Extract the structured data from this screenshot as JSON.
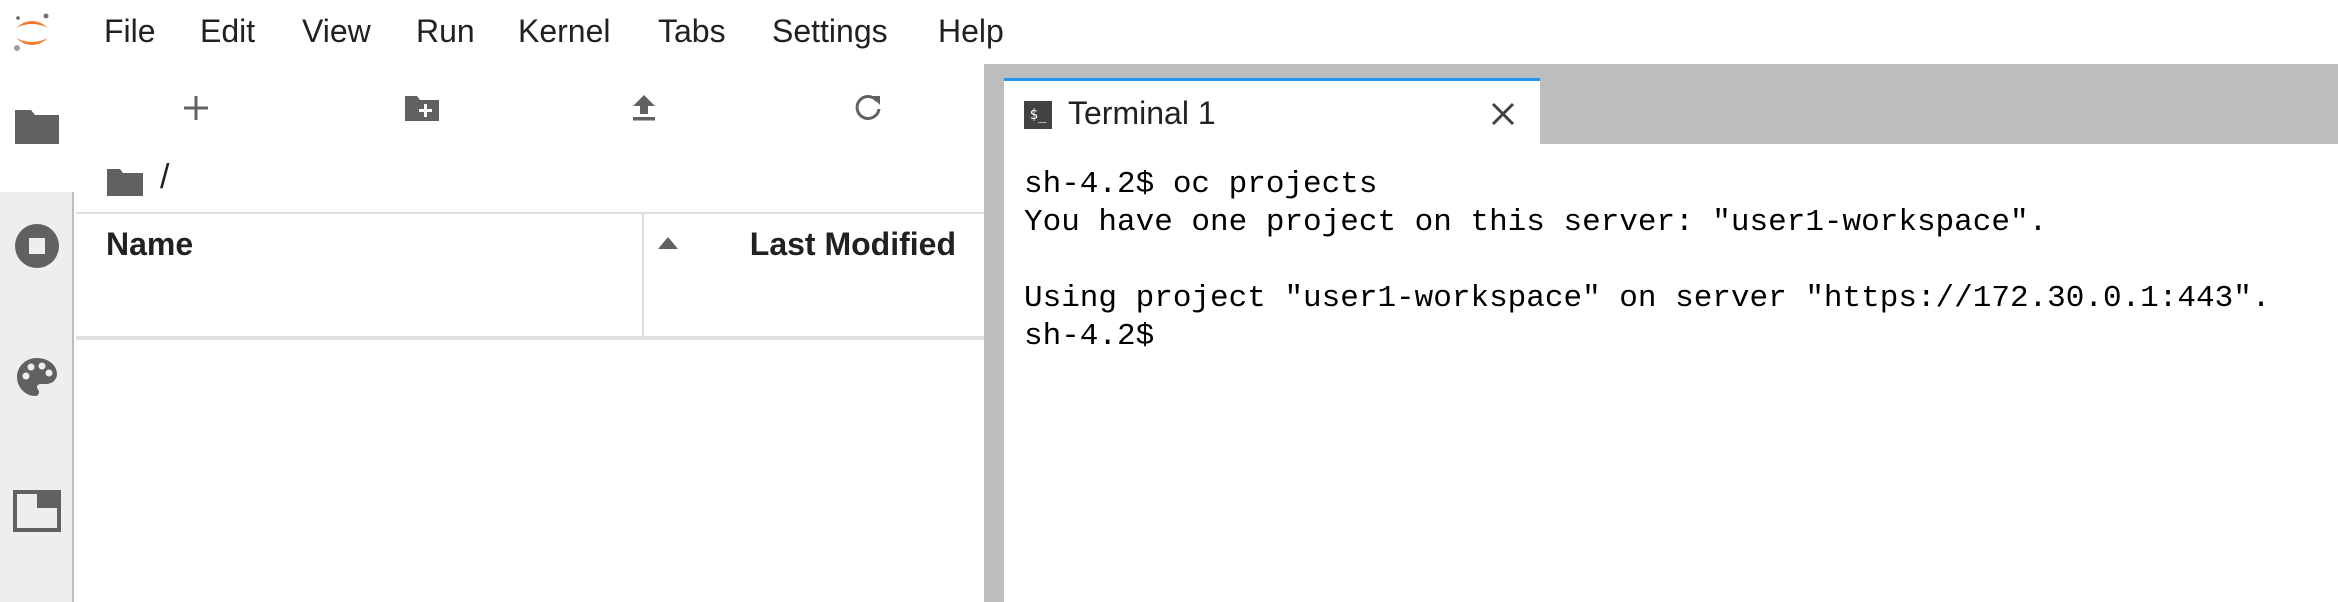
{
  "menubar": {
    "logo": "jupyter-logo",
    "items": [
      "File",
      "Edit",
      "View",
      "Run",
      "Kernel",
      "Tabs",
      "Settings",
      "Help"
    ]
  },
  "activity_bar": {
    "tabs": [
      {
        "icon": "folder-icon",
        "active": true
      },
      {
        "icon": "stop-circle-icon",
        "active": false
      },
      {
        "icon": "palette-icon",
        "active": false
      },
      {
        "icon": "tabs-icon",
        "active": false
      }
    ]
  },
  "file_browser": {
    "toolbar": [
      "plus-icon",
      "new-folder-icon",
      "upload-icon",
      "refresh-icon"
    ],
    "breadcrumb": "/",
    "columns": {
      "name": "Name",
      "modified": "Last Modified"
    }
  },
  "dock": {
    "tab": {
      "icon_text": "$_",
      "label": "Terminal 1"
    },
    "terminal_lines": [
      "sh-4.2$ oc projects",
      "You have one project on this server: \"user1-workspace\".",
      "",
      "Using project \"user1-workspace\" on server \"https://172.30.0.1:443\".",
      "sh-4.2$ "
    ]
  },
  "colors": {
    "accent": "#2196f3",
    "logo_orange": "#f37726",
    "sidebar_bg": "#eeeeee",
    "splitter": "#bdbdbd"
  }
}
